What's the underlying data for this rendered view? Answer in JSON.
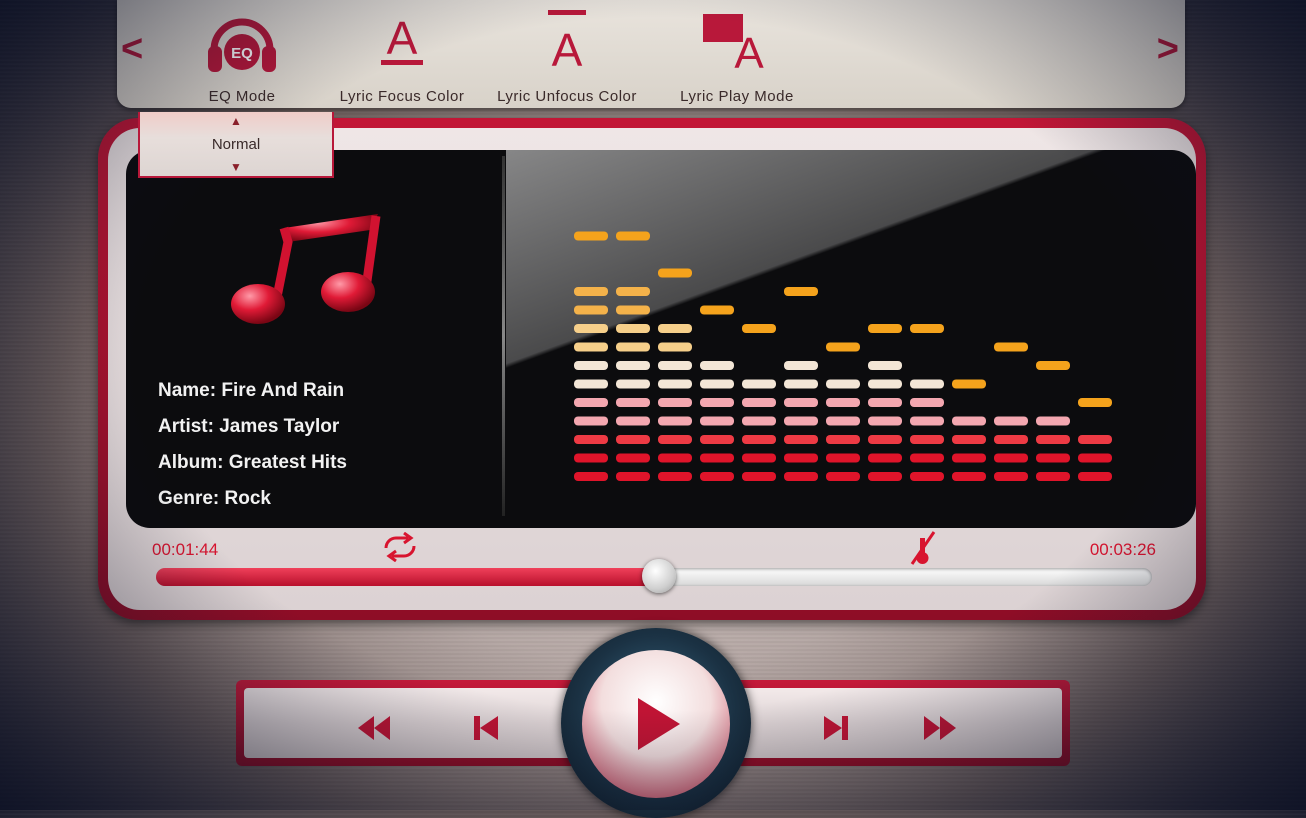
{
  "toolbar": {
    "prev_label": "<",
    "next_label": ">",
    "items": [
      {
        "label": "EQ Mode",
        "icon": "headphones-eq-icon",
        "icon_text": "EQ"
      },
      {
        "label": "Lyric Focus Color",
        "icon": "text-color-underline-icon",
        "icon_text": "A"
      },
      {
        "label": "Lyric Unfocus Color",
        "icon": "text-color-overline-icon",
        "icon_text": "A"
      },
      {
        "label": "Lyric Play Mode",
        "icon": "text-highlight-icon",
        "icon_text": "A"
      }
    ]
  },
  "eq_dropdown": {
    "selected": "Normal"
  },
  "track": {
    "name": "Name: Fire And Rain",
    "artist": "Artist: James Taylor",
    "album": "Album: Greatest Hits",
    "genre": "Genre: Rock"
  },
  "visualizer": {
    "levels": [
      11,
      11,
      9,
      7,
      6,
      7,
      6,
      7,
      6,
      4,
      4,
      4,
      3
    ],
    "peaks": [
      13,
      13,
      11,
      9,
      8,
      10,
      7,
      8,
      8,
      5,
      7,
      6,
      4
    ],
    "max_level": 13
  },
  "playback": {
    "elapsed": "00:01:44",
    "total": "00:03:26",
    "progress": 0.505
  },
  "colors": {
    "accent": "#c21636",
    "time_text": "#d8142f"
  }
}
